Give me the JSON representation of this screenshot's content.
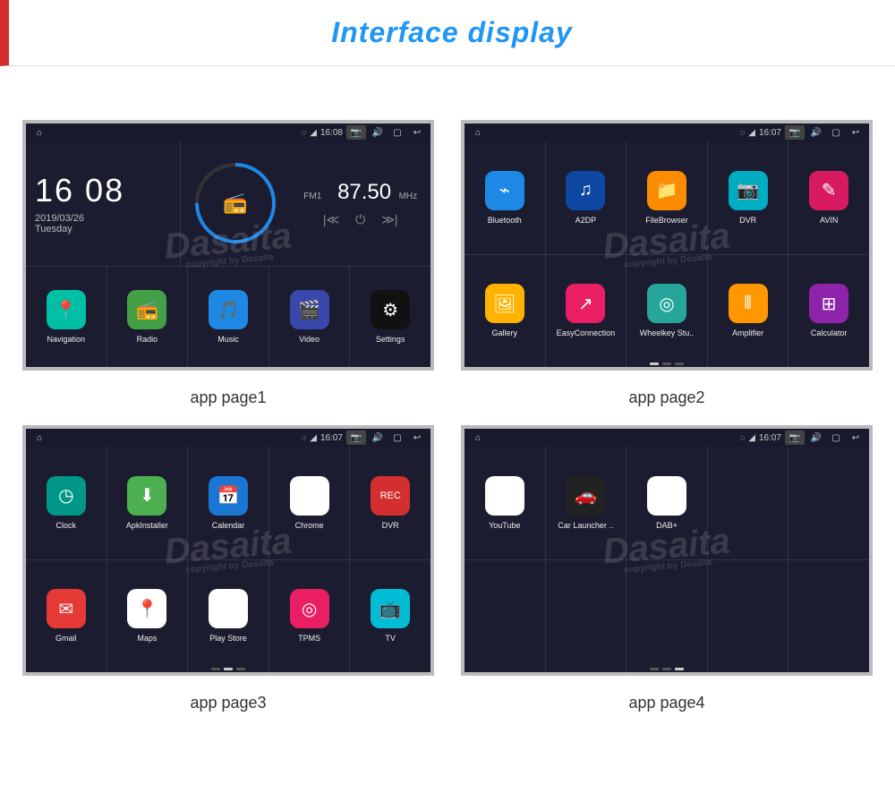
{
  "header": {
    "title": "Interface display"
  },
  "watermark": {
    "brand": "Dasaita",
    "sub": "copyright by Dasaita"
  },
  "captions": {
    "p1": "app page1",
    "p2": "app page2",
    "p3": "app page3",
    "p4": "app page4"
  },
  "statusbar": {
    "time1": "16:08",
    "time2": "16:07",
    "time3": "16:07",
    "time4": "16:07"
  },
  "panel1": {
    "clock": {
      "time": "16 08",
      "date": "2019/03/26",
      "day": "Tuesday"
    },
    "radio": {
      "band": "FM1",
      "freq": "87.50",
      "unit": "MHz"
    },
    "apps": [
      {
        "label": "Navigation",
        "color": "#00bfa5",
        "glyph": "📍"
      },
      {
        "label": "Radio",
        "color": "#43a047",
        "glyph": "📻"
      },
      {
        "label": "Music",
        "color": "#1e88e5",
        "glyph": "🎵"
      },
      {
        "label": "Video",
        "color": "#3949ab",
        "glyph": "🎬"
      },
      {
        "label": "Settings",
        "color": "#111",
        "glyph": "⚙"
      }
    ]
  },
  "panel2": {
    "apps": [
      {
        "label": "Bluetooth",
        "color": "#1e88e5",
        "glyph": "⌁"
      },
      {
        "label": "A2DP",
        "color": "#0d47a1",
        "glyph": "♫"
      },
      {
        "label": "FileBrowser",
        "color": "#fb8c00",
        "glyph": "📁"
      },
      {
        "label": "DVR",
        "color": "#00acc1",
        "glyph": "📷"
      },
      {
        "label": "AVIN",
        "color": "#d81b60",
        "glyph": "✎"
      },
      {
        "label": "Gallery",
        "color": "#ffb300",
        "glyph": "🖼"
      },
      {
        "label": "EasyConnection",
        "color": "#e91e63",
        "glyph": "↗"
      },
      {
        "label": "Wheelkey Stu..",
        "color": "#26a69a",
        "glyph": "◎"
      },
      {
        "label": "Amplifier",
        "color": "#ff9800",
        "glyph": "⫴"
      },
      {
        "label": "Calculator",
        "color": "#8e24aa",
        "glyph": "⊞"
      }
    ],
    "activeDot": 0
  },
  "panel3": {
    "apps": [
      {
        "label": "Clock",
        "color": "#009688",
        "glyph": "◷"
      },
      {
        "label": "ApkInstaller",
        "color": "#4caf50",
        "glyph": "⬇"
      },
      {
        "label": "Calendar",
        "color": "#1976d2",
        "glyph": "📅"
      },
      {
        "label": "Chrome",
        "color": "#fff",
        "glyph": "◉"
      },
      {
        "label": "DVR",
        "color": "#d32f2f",
        "glyph": "REC"
      },
      {
        "label": "Gmail",
        "color": "#e53935",
        "glyph": "✉"
      },
      {
        "label": "Maps",
        "color": "#fff",
        "glyph": "📍"
      },
      {
        "label": "Play Store",
        "color": "#fff",
        "glyph": "▶"
      },
      {
        "label": "TPMS",
        "color": "#e91e63",
        "glyph": "◎"
      },
      {
        "label": "TV",
        "color": "#00bcd4",
        "glyph": "📺"
      }
    ],
    "activeDot": 1
  },
  "panel4": {
    "apps": [
      {
        "label": "YouTube",
        "color": "#fff",
        "glyph": "▶"
      },
      {
        "label": "Car Launcher ..",
        "color": "#222",
        "glyph": "🚗"
      },
      {
        "label": "DAB+",
        "color": "#fff",
        "glyph": "◔"
      }
    ],
    "activeDot": 2
  }
}
